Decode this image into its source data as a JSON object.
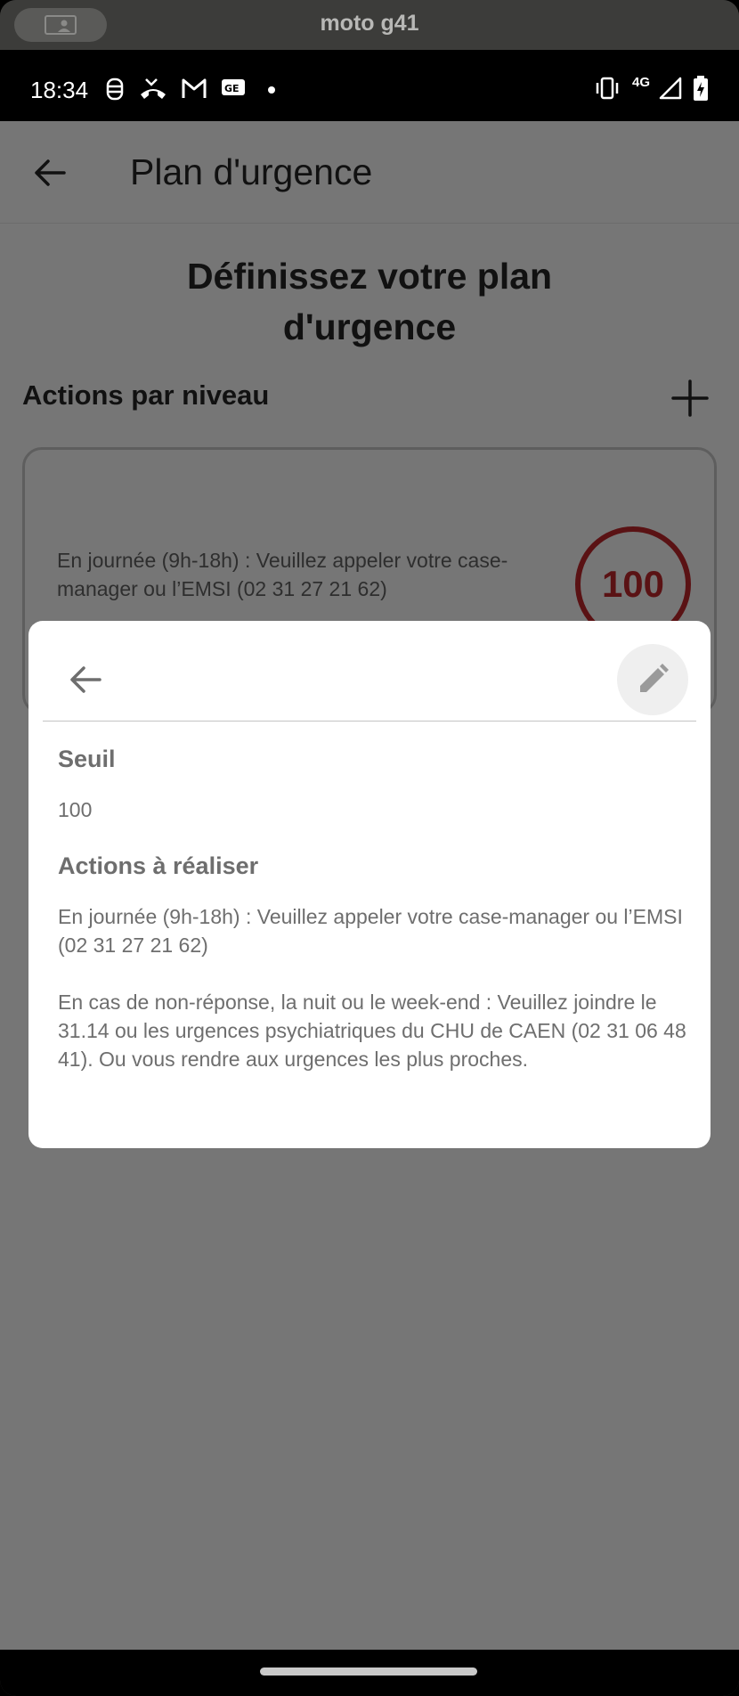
{
  "device": {
    "title": "moto g41"
  },
  "status_bar": {
    "time": "18:34",
    "network": "4G",
    "icons": [
      "data-saver-icon",
      "missed-call-icon",
      "gmail-icon",
      "news-icon",
      "dot-icon",
      "vibrate-icon",
      "signal-icon",
      "battery-charging-icon"
    ]
  },
  "app_bar": {
    "title": "Plan d'urgence"
  },
  "page": {
    "heading_line1": "Définissez votre plan",
    "heading_line2": "d'urgence",
    "section_title": "Actions par niveau"
  },
  "level_card": {
    "text": "En journée (9h-18h) : Veuillez appeler votre case-manager ou l’EMSI (02 31 27 21 62)",
    "badge": "100",
    "badge_color": "#5a1214"
  },
  "modal": {
    "threshold_label": "Seuil",
    "threshold_value": "100",
    "actions_label": "Actions à réaliser",
    "action_1": "En journée (9h-18h) : Veuillez appeler votre case-manager ou l’EMSI (02 31 27 21 62)",
    "action_2": "En cas de non-réponse, la nuit ou le week-end : Veuillez joindre le 31.14 ou les urgences psychiatriques du CHU de CAEN (02 31 06 48 41). Ou vous rendre aux urgences les plus proches."
  },
  "colors": {
    "scrim": "#767676",
    "modal_bg": "#ffffff",
    "modal_text": "#6e6e6e"
  }
}
